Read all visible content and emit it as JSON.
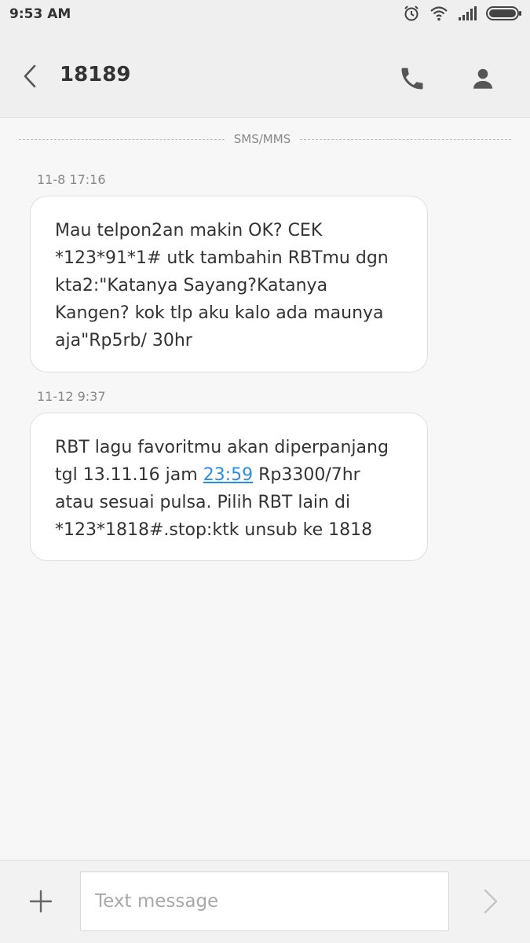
{
  "status_bar": {
    "time": "9:53 AM",
    "icons": [
      "alarm-icon",
      "wifi-icon",
      "signal-icon",
      "battery-icon"
    ]
  },
  "header": {
    "title": "18189",
    "icons": [
      "back-chevron-icon",
      "phone-icon",
      "contact-icon"
    ]
  },
  "thread": {
    "divider_label": "SMS/MMS",
    "messages": [
      {
        "timestamp": "11-8 17:16",
        "text": "Mau telpon2an makin OK? CEK *123*91*1# utk tambahin RBTmu dgn kta2:\"Katanya Sayang?Katanya Kangen? kok tlp aku kalo ada maunya aja\"Rp5rb/ 30hr"
      },
      {
        "timestamp": "11-12 9:37",
        "text_before": "RBT lagu favoritmu akan diperpanjang tgl 13.11.16 jam ",
        "link": "23:59",
        "text_after": " Rp3300/7hr atau sesuai pulsa. Pilih RBT lain di *123*1818#.stop:ktk unsub ke 1818"
      }
    ]
  },
  "composer": {
    "placeholder": "Text message",
    "value": "",
    "icons": [
      "plus-icon",
      "send-chevron-icon"
    ]
  },
  "colors": {
    "background": "#f7f7f7",
    "header": "#efefef",
    "bubble": "#ffffff",
    "link": "#2a8de4"
  }
}
